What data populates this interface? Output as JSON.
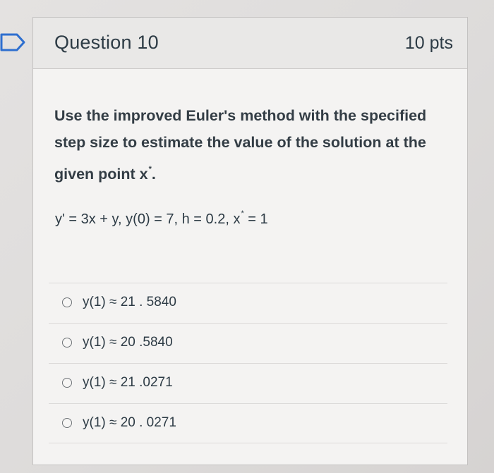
{
  "question": {
    "title": "Question 10",
    "points": "10 pts",
    "prompt": "Use the improved Euler's method with the specified step size to estimate the value of the solution at the given point x",
    "prompt_end": ".",
    "equation_main": "y' = 3x + y, y(0) = 7, h = 0.2, x",
    "equation_end": " = 1",
    "star": "*"
  },
  "answers": [
    {
      "label": "y(1) ≈ 21 . 5840"
    },
    {
      "label": "y(1) ≈ 20 .5840"
    },
    {
      "label": "y(1) ≈ 21 .0271"
    },
    {
      "label": "y(1) ≈ 20 . 0271"
    }
  ],
  "colors": {
    "flag": "#2e6fcf",
    "text": "#2d3b45"
  }
}
